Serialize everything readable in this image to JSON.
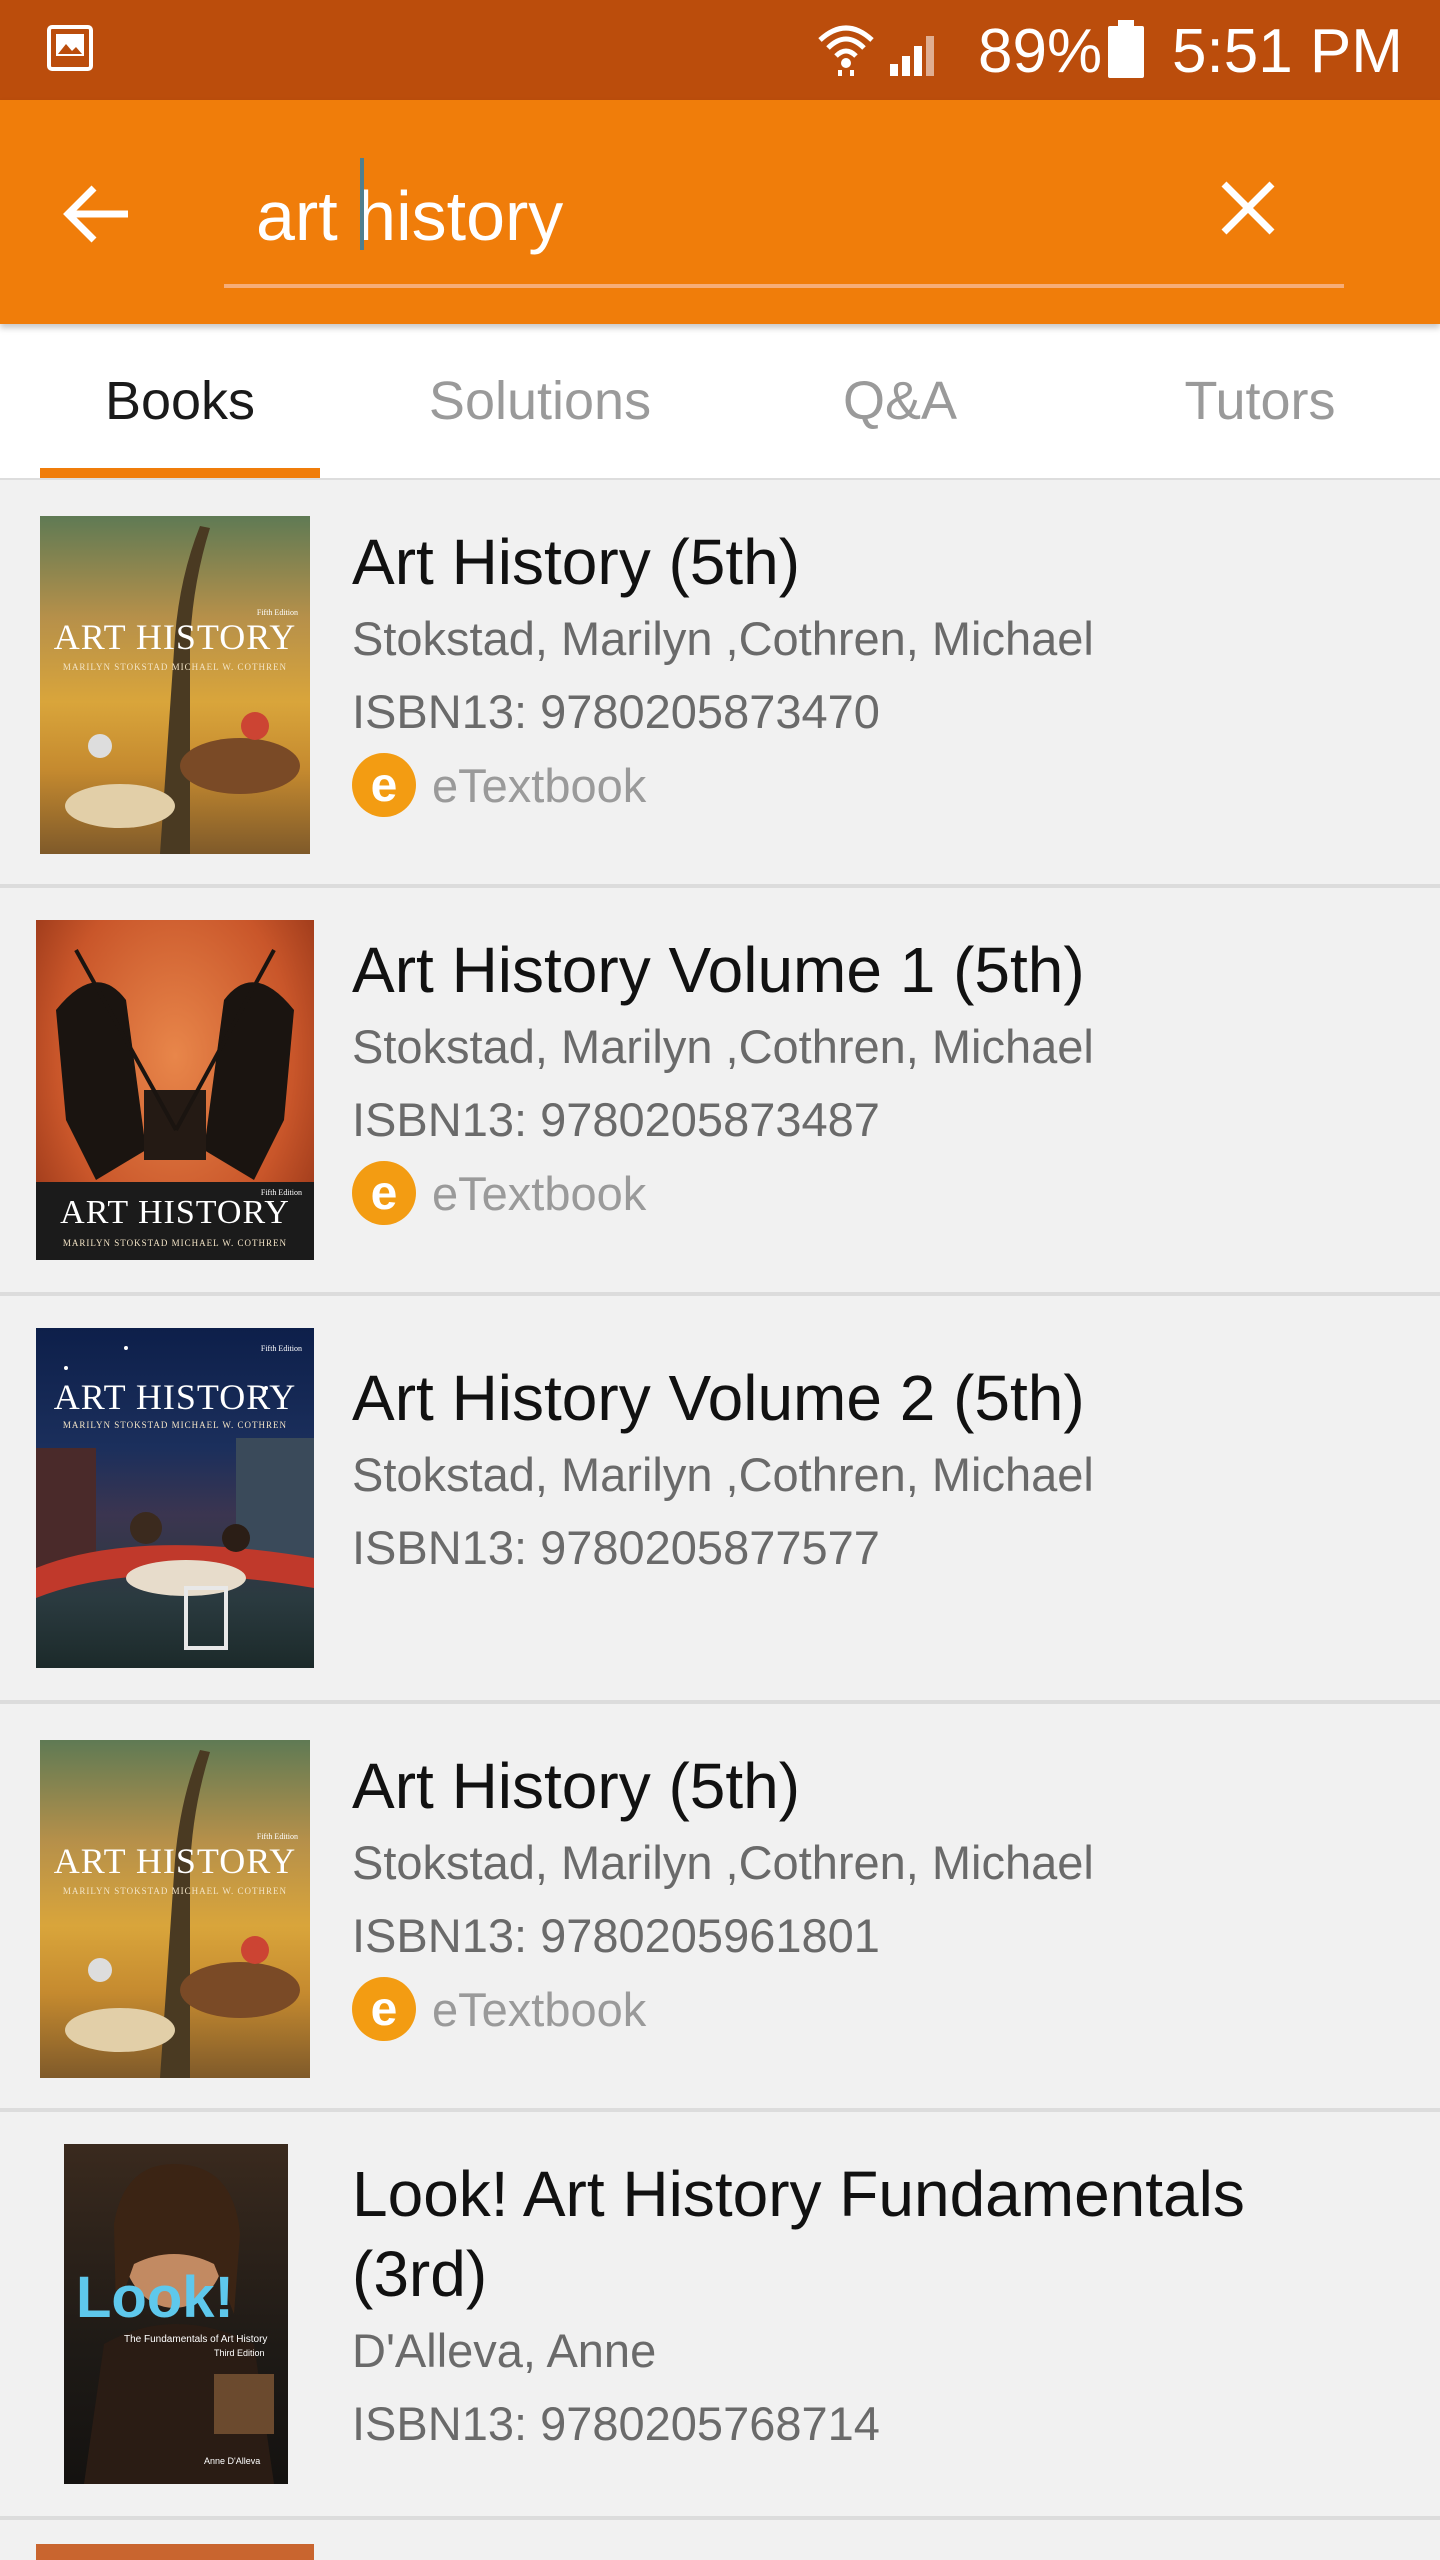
{
  "status_bar": {
    "battery_percent": "89%",
    "time": "5:51 PM",
    "icons": [
      "gallery-icon",
      "wifi-icon",
      "signal-icon",
      "battery-icon"
    ]
  },
  "toolbar": {
    "search_value": "art history",
    "back_icon": "arrow-left-icon",
    "clear_icon": "close-icon",
    "background": "#f07d0a"
  },
  "tabs": [
    {
      "label": "Books",
      "active": true
    },
    {
      "label": "Solutions",
      "active": false
    },
    {
      "label": "Q&A",
      "active": false
    },
    {
      "label": "Tutors",
      "active": false
    }
  ],
  "colors": {
    "accent": "#f07d0a",
    "status_bar": "#bb4d0c",
    "etextbook_badge": "#f39c12"
  },
  "books": [
    {
      "title": "Art History (5th)",
      "authors": "Stokstad, Marilyn ,Cothren, Michael",
      "isbn": "ISBN13: 9780205873470",
      "etextbook": true,
      "etextbook_label": "eTextbook",
      "etextbook_badge": "e",
      "cover_title": "ART HISTORY",
      "cover_authors": "MARILYN STOKSTAD   MICHAEL W. COTHREN",
      "cover_edition": "Fifth Edition"
    },
    {
      "title": "Art History Volume 1 (5th)",
      "authors": "Stokstad, Marilyn ,Cothren, Michael",
      "isbn": "ISBN13: 9780205873487",
      "etextbook": true,
      "etextbook_label": "eTextbook",
      "etextbook_badge": "e",
      "cover_title": "ART HISTORY",
      "cover_authors": "MARILYN STOKSTAD   MICHAEL W. COTHREN",
      "cover_edition": "Fifth Edition"
    },
    {
      "title": "Art History Volume 2 (5th)",
      "authors": "Stokstad, Marilyn ,Cothren, Michael",
      "isbn": "ISBN13: 9780205877577",
      "etextbook": false,
      "cover_title": "ART HISTORY",
      "cover_authors": "MARILYN STOKSTAD   MICHAEL W. COTHREN",
      "cover_edition": "Fifth Edition"
    },
    {
      "title": "Art History (5th)",
      "authors": "Stokstad, Marilyn ,Cothren, Michael",
      "isbn": "ISBN13: 9780205961801",
      "etextbook": true,
      "etextbook_label": "eTextbook",
      "etextbook_badge": "e",
      "cover_title": "ART HISTORY",
      "cover_authors": "MARILYN STOKSTAD   MICHAEL W. COTHREN",
      "cover_edition": "Fifth Edition"
    },
    {
      "title": "Look! Art History Fundamentals (3rd)",
      "authors": "D'Alleva, Anne",
      "isbn": "ISBN13: 9780205768714",
      "etextbook": false,
      "cover_title": "Look!",
      "cover_subtitle": "The Fundamentals of Art History",
      "cover_edition": "Third Edition",
      "cover_authors": "Anne D'Alleva"
    }
  ]
}
